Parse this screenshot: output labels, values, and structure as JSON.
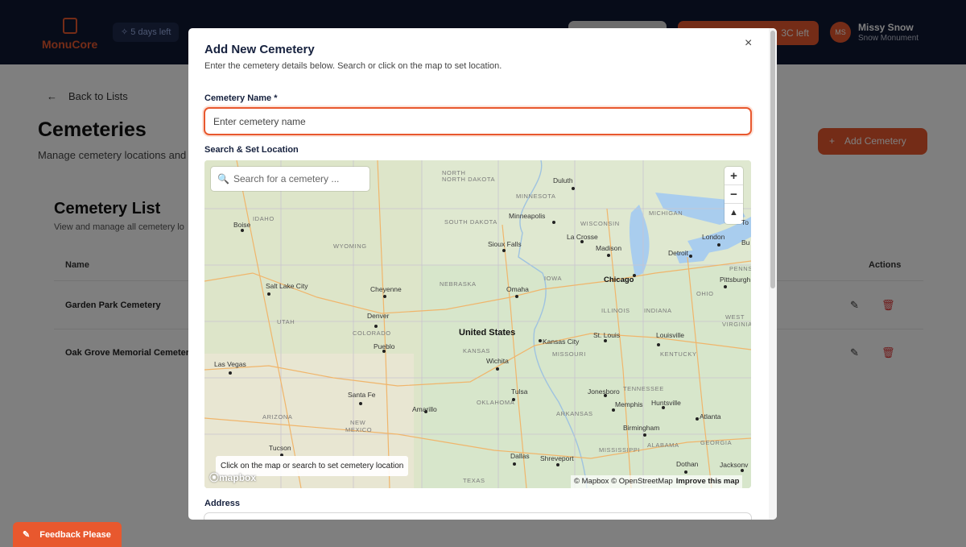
{
  "app": {
    "logo_prefix": "Monu",
    "logo_suffix": "Core",
    "trial_badge": "5 days left"
  },
  "header": {
    "top_button_label": "3C left",
    "user_initials": "MS",
    "user_name": "Missy Snow",
    "user_company": "Snow Monument"
  },
  "page": {
    "back_label": "Back to Lists",
    "title": "Cemeteries",
    "subtitle": "Manage cemetery locations and",
    "add_button": "Add Cemetery",
    "list_title": "Cemetery List",
    "list_subtitle": "View and manage all cemetery lo",
    "columns": {
      "name": "Name",
      "actions": "Actions"
    },
    "rows": [
      {
        "name": "Garden Park Cemetery"
      },
      {
        "name": "Oak Grove Memorial Cemetery"
      }
    ]
  },
  "feedback": {
    "label": "Feedback Please"
  },
  "modal": {
    "title": "Add New Cemetery",
    "subtitle": "Enter the cemetery details below. Search or click on the map to set location.",
    "name_label": "Cemetery Name *",
    "name_placeholder": "Enter cemetery name",
    "name_value": "",
    "location_label": "Search & Set Location",
    "address_label": "Address",
    "close_icon": "close-icon"
  },
  "map": {
    "search_placeholder": "Search for a cemetery ...",
    "hint": "Click on the map or search to set cemetery location",
    "logo": "mapbox",
    "attribution": {
      "mapbox": "© Mapbox",
      "osm": "© OpenStreetMap",
      "improve": "Improve this map"
    },
    "zoom_in": "+",
    "zoom_out": "−",
    "compass": "▲",
    "country": "United States",
    "regions": {
      "north_dakota": "NORTH DAKOTA",
      "south_dakota": "SOUTH DAKOTA",
      "minnesota": "MINNESOTA",
      "wisconsin": "WISCONSIN",
      "michigan": "MICHIGAN",
      "idaho": "IDAHO",
      "wyoming": "WYOMING",
      "nebraska": "NEBRASKA",
      "iowa": "IOWA",
      "illinois": "ILLINOIS",
      "indiana": "INDIANA",
      "ohio": "OHIO",
      "pennsylvania": "PENNS",
      "utah": "UTAH",
      "colorado": "COLORADO",
      "kansas": "KANSAS",
      "missouri": "MISSOURI",
      "kentucky": "KENTUCKY",
      "west_virginia_1": "WEST",
      "west_virginia_2": "VIRGINIA",
      "tennessee": "TENNESSEE",
      "oklahoma": "OKLAHOMA",
      "arkansas": "ARKANSAS",
      "arizona": "ARIZONA",
      "new_mexico_1": "NEW",
      "new_mexico_2": "MEXICO",
      "mississippi": "MISSISSIPPI",
      "alabama": "ALABAMA",
      "georgia": "GEORGIA",
      "texas": "TEXAS",
      "north": "NORTH"
    },
    "cities": {
      "duluth": "Duluth",
      "minneapolis": "Minneapolis",
      "boise": "Boise",
      "la_crosse": "La Crosse",
      "sioux_falls": "Sioux Falls",
      "madison": "Madison",
      "london": "London",
      "detroit": "Detroit",
      "buffalo": "Bu",
      "toronto": "To",
      "salt_lake_city": "Salt Lake City",
      "cheyenne": "Cheyenne",
      "omaha": "Omaha",
      "chicago": "Chicago",
      "pittsburgh": "Pittsburgh",
      "denver": "Denver",
      "kansas_city": "Kansas City",
      "st_louis": "St. Louis",
      "louisville": "Louisville",
      "pueblo": "Pueblo",
      "wichita": "Wichita",
      "las_vegas": "Las Vegas",
      "tulsa": "Tulsa",
      "jonesboro": "Jonesboro",
      "santa_fe": "Santa Fe",
      "amarillo": "Amarillo",
      "memphis": "Memphis",
      "huntsville": "Huntsville",
      "birmingham": "Birmingham",
      "atlanta": "Atlanta",
      "tucson": "Tucson",
      "dallas": "Dallas",
      "shreveport": "Shreveport",
      "dothan": "Dothan",
      "jacksonville": "Jacksonv"
    }
  }
}
